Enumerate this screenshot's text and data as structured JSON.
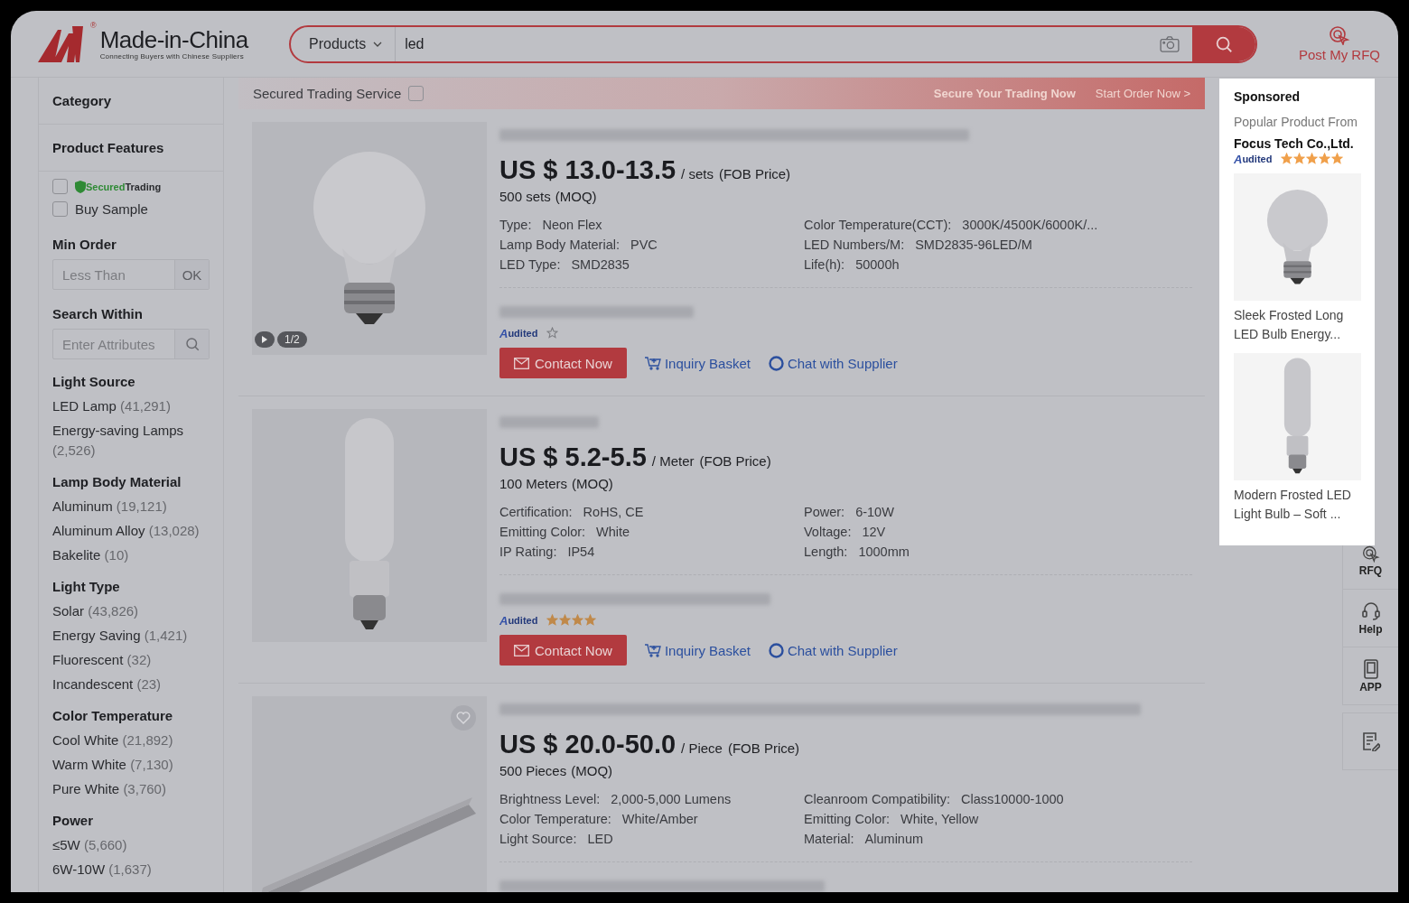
{
  "header": {
    "logo": {
      "name": "Made-in-China",
      "tagline": "Connecting Buyers with Chinese Suppliers",
      "mark": "®"
    },
    "search": {
      "category": "Products",
      "value": "led"
    },
    "rfq": "Post My RFQ"
  },
  "sidebar": {
    "sections": [
      {
        "title": "Category"
      },
      {
        "title": "Product Features"
      }
    ],
    "features": [
      {
        "kind": "secured",
        "initial": "S",
        "rest": "ecured",
        "second": "Trading",
        "checked": false
      },
      {
        "kind": "text",
        "label": "Buy Sample",
        "checked": false
      }
    ],
    "min_order": {
      "title": "Min Order",
      "placeholder": "Less Than",
      "button": "OK"
    },
    "search_within": {
      "title": "Search Within",
      "placeholder": "Enter Attributes"
    },
    "filters": [
      {
        "title": "Light Source",
        "options": [
          {
            "label": "LED Lamp",
            "count": "(41,291)"
          },
          {
            "label": "Energy-saving Lamps",
            "count": "(2,526)"
          }
        ]
      },
      {
        "title": "Lamp Body Material",
        "options": [
          {
            "label": "Aluminum",
            "count": "(19,121)"
          },
          {
            "label": "Aluminum Alloy",
            "count": "(13,028)"
          },
          {
            "label": "Bakelite",
            "count": "(10)"
          }
        ]
      },
      {
        "title": "Light Type",
        "options": [
          {
            "label": "Solar",
            "count": "(43,826)"
          },
          {
            "label": "Energy Saving",
            "count": "(1,421)"
          },
          {
            "label": "Fluorescent",
            "count": "(32)"
          },
          {
            "label": "Incandescent",
            "count": "(23)"
          }
        ]
      },
      {
        "title": "Color Temperature",
        "options": [
          {
            "label": "Cool White",
            "count": "(21,892)"
          },
          {
            "label": "Warm White",
            "count": "(7,130)"
          },
          {
            "label": "Pure White",
            "count": "(3,760)"
          }
        ]
      },
      {
        "title": "Power",
        "options": [
          {
            "label": "≤5W",
            "count": "(5,660)"
          },
          {
            "label": "6W-10W",
            "count": "(1,637)"
          }
        ]
      }
    ]
  },
  "banner": {
    "label": "Secured Trading Service",
    "checked": false,
    "slogan": "Secure Your Trading Now",
    "link": "Start Order Now",
    "arrow": ">"
  },
  "products": [
    {
      "kind": "bulb",
      "image_counter": "1/2",
      "price": "US $ 13.0-13.5",
      "unit": "/ sets",
      "terms": "(FOB Price)",
      "moq": "500 sets",
      "moq_label": "(MOQ)",
      "specs_left": [
        {
          "label": "Type:",
          "value": "Neon Flex"
        },
        {
          "label": "Lamp Body Material:",
          "value": "PVC"
        },
        {
          "label": "LED Type:",
          "value": "SMD2835"
        }
      ],
      "specs_right": [
        {
          "label": "Color Temperature(CCT):",
          "value": "3000K/4500K/6000K/..."
        },
        {
          "label": "LED Numbers/M:",
          "value": "SMD2835-96LED/M"
        },
        {
          "label": "Life(h):",
          "value": "50000h"
        }
      ],
      "audit": {
        "initial": "A",
        "rest": "udited"
      },
      "actions": [
        "Contact Now",
        "Inquiry Basket",
        "Chat with Supplier"
      ]
    },
    {
      "kind": "tube",
      "price": "US $ 5.2-5.5",
      "unit": "/ Meter",
      "terms": "(FOB Price)",
      "moq": "100 Meters",
      "moq_label": "(MOQ)",
      "specs_left": [
        {
          "label": "Certification:",
          "value": "RoHS, CE"
        },
        {
          "label": "Emitting Color:",
          "value": "White"
        },
        {
          "label": "IP Rating:",
          "value": "IP54"
        }
      ],
      "specs_right": [
        {
          "label": "Power:",
          "value": "6-10W"
        },
        {
          "label": "Voltage:",
          "value": "12V"
        },
        {
          "label": "Length:",
          "value": "1000mm"
        }
      ],
      "audit": {
        "initial": "A",
        "rest": "udited"
      },
      "stars": 4,
      "actions": [
        "Contact Now",
        "Inquiry Basket",
        "Chat with Supplier"
      ]
    },
    {
      "kind": "bar",
      "hovered": true,
      "price": "US $ 20.0-50.0",
      "unit": "/ Piece",
      "terms": "(FOB Price)",
      "moq": "500 Pieces",
      "moq_label": "(MOQ)",
      "specs_left": [
        {
          "label": "Brightness Level:",
          "value": "2,000-5,000 Lumens"
        },
        {
          "label": "Color Temperature:",
          "value": "White/Amber"
        },
        {
          "label": "Light Source:",
          "value": "LED"
        }
      ],
      "specs_right": [
        {
          "label": "Cleanroom Compatibility:",
          "value": "Class10000-1000"
        },
        {
          "label": "Emitting Color:",
          "value": "White, Yellow"
        },
        {
          "label": "Material:",
          "value": "Aluminum"
        }
      ]
    }
  ],
  "rail": [
    {
      "kind": "rfq",
      "label": "RFQ"
    },
    {
      "kind": "help",
      "label": "Help"
    },
    {
      "kind": "app",
      "label": "APP"
    },
    {
      "kind": "feedback"
    }
  ],
  "sponsored": {
    "title": "Sponsored",
    "subtitle": "Popular Product From",
    "company": "Focus Tech Co.,Ltd.",
    "audit": {
      "initial": "A",
      "rest": "udited"
    },
    "stars": 5,
    "items": [
      {
        "kind": "bulb",
        "title": "Sleek Frosted Long LED Bulb  Energy..."
      },
      {
        "kind": "tube",
        "title": "Modern Frosted LED Light Bulb – Soft ..."
      }
    ]
  }
}
